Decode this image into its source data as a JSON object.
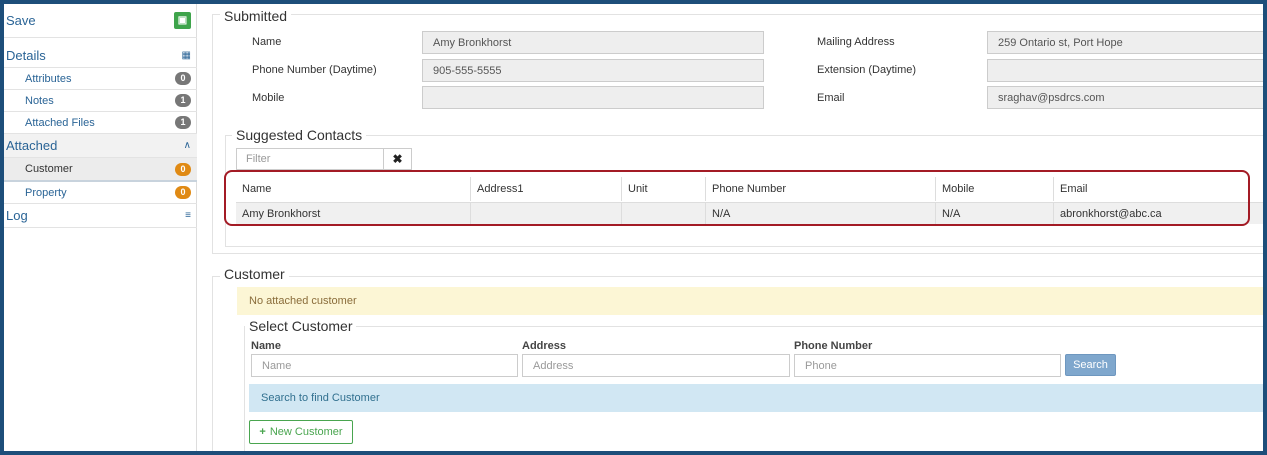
{
  "sidebar": {
    "save": {
      "label": "Save",
      "icon": "save-icon"
    },
    "details": {
      "label": "Details"
    },
    "attributes": {
      "label": "Attributes",
      "count": "0"
    },
    "notes": {
      "label": "Notes",
      "count": "1"
    },
    "attached_files": {
      "label": "Attached Files",
      "count": "1"
    },
    "attached": {
      "label": "Attached"
    },
    "customer": {
      "label": "Customer",
      "count": "0"
    },
    "property": {
      "label": "Property",
      "count": "0"
    },
    "log": {
      "label": "Log"
    }
  },
  "submitted": {
    "legend": "Submitted",
    "name_label": "Name",
    "name_value": "Amy Bronkhorst",
    "phone_label": "Phone Number (Daytime)",
    "phone_value": "905-555-5555",
    "mobile_label": "Mobile",
    "mobile_value": "",
    "mailing_label": "Mailing Address",
    "mailing_value": "259 Ontario st, Port Hope",
    "extension_label": "Extension (Daytime)",
    "extension_value": "",
    "email_label": "Email",
    "email_value": "sraghav@psdrcs.com"
  },
  "suggested": {
    "legend": "Suggested Contacts",
    "filter_placeholder": "Filter",
    "clear_symbol": "✖",
    "columns": [
      "Name",
      "Address1",
      "Unit",
      "Phone Number",
      "Mobile",
      "Email"
    ],
    "rows": [
      [
        "Amy Bronkhorst",
        "",
        "",
        "N/A",
        "N/A",
        "abronkhorst@abc.ca"
      ]
    ]
  },
  "customer": {
    "legend": "Customer",
    "notice": "No attached customer",
    "select_legend": "Select Customer",
    "name_label": "Name",
    "name_placeholder": "Name",
    "address_label": "Address",
    "address_placeholder": "Address",
    "phone_label": "Phone Number",
    "phone_placeholder": "Phone",
    "search_button": "Search",
    "info": "Search to find Customer",
    "new_button": "New Customer"
  },
  "colors": {
    "frame": "#1d4e7a",
    "link": "#2a6496",
    "highlight": "#a31b25",
    "success": "#49a54f",
    "warning_badge": "#e08a14"
  }
}
